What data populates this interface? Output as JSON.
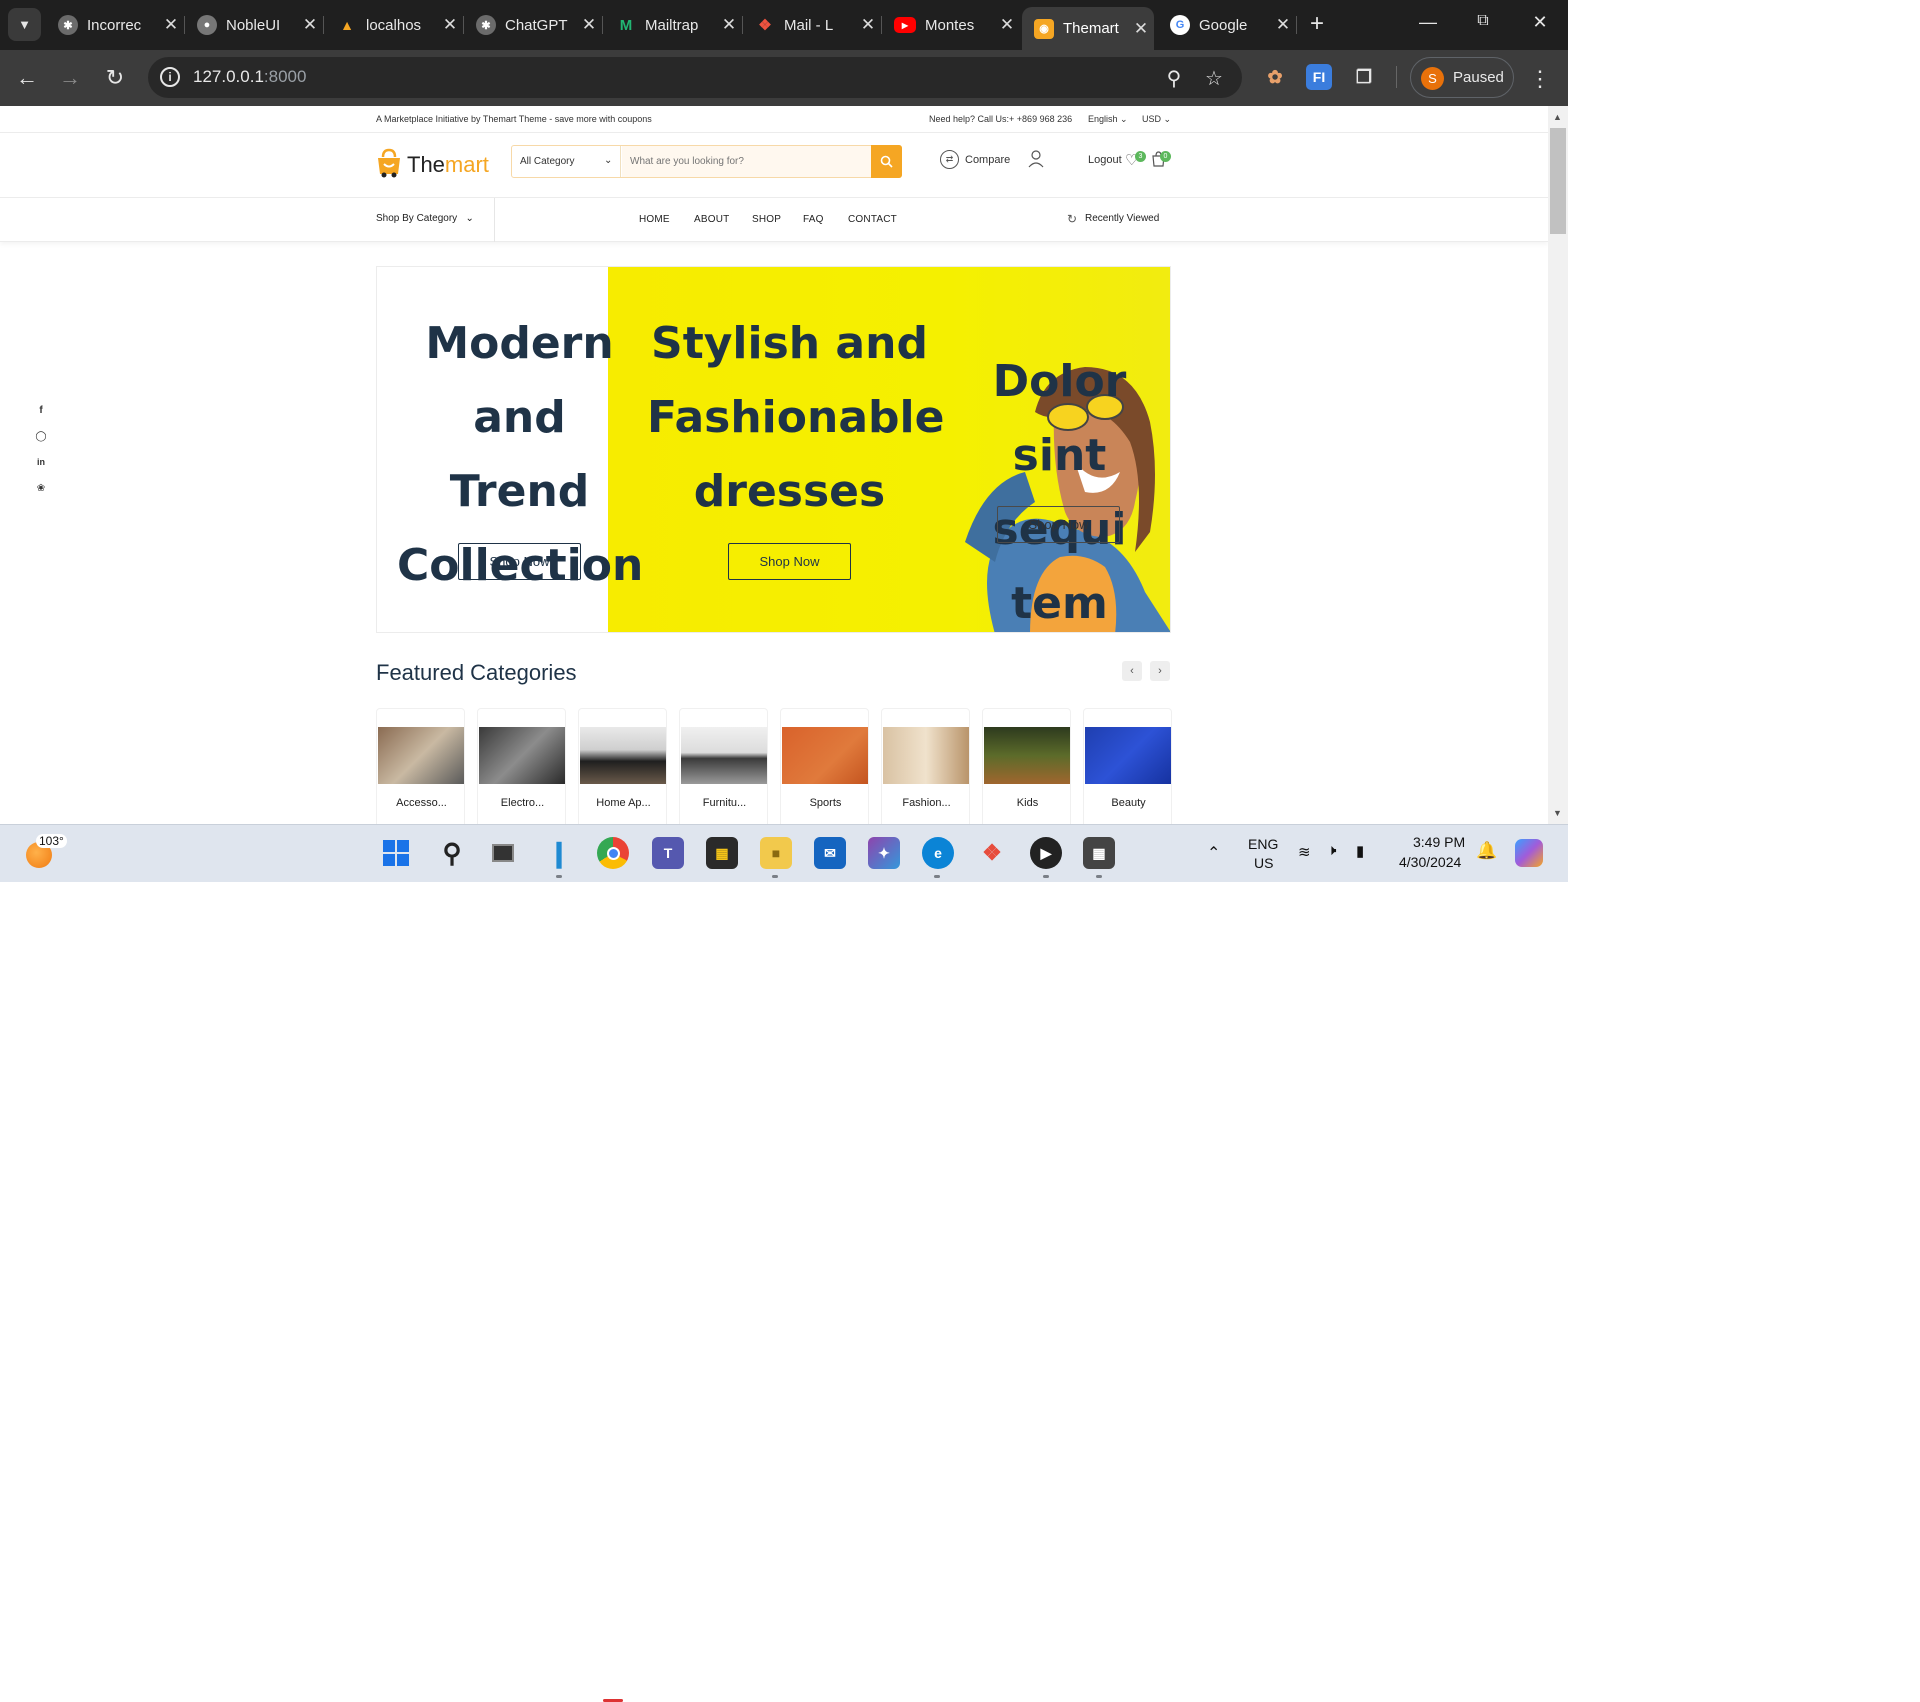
{
  "browser": {
    "tabs": [
      {
        "title": "Incorrec",
        "icon": "chatgpt-icon",
        "color": "#6b6b6b"
      },
      {
        "title": "NobleUI",
        "icon": "globe-icon",
        "color": "#777777"
      },
      {
        "title": "localhos",
        "icon": "localhost-icon",
        "color": "#333333"
      },
      {
        "title": "ChatGPT",
        "icon": "chatgpt-icon",
        "color": "#6b6b6b"
      },
      {
        "title": "Mailtrap",
        "icon": "mailtrap-icon",
        "color": "#22b573"
      },
      {
        "title": "Mail - L",
        "icon": "laravel-icon",
        "color": "#f05340"
      },
      {
        "title": "Montes",
        "icon": "youtube-icon",
        "color": "#ff0000"
      },
      {
        "title": "Themart",
        "icon": "themart-icon",
        "color": "#f5a623"
      },
      {
        "title": "Google",
        "icon": "google-icon",
        "color": "#4285f4"
      }
    ],
    "active_tab_index": 7,
    "url_host": "127.0.0.1",
    "url_port": ":8000",
    "profile_initial": "S",
    "profile_label": "Paused"
  },
  "site": {
    "topbar": {
      "tagline": "A Marketplace Initiative by Themart Theme - save more with coupons",
      "help": "Need help? Call Us:+ +869 968 236",
      "language": "English",
      "currency": "USD"
    },
    "logo": {
      "part1": "The",
      "part2": "mart"
    },
    "search": {
      "category": "All Category",
      "placeholder": "What are you looking for?"
    },
    "header_links": {
      "compare": "Compare",
      "logout": "Logout",
      "wishlist_count": "3",
      "cart_count": "0"
    },
    "nav": {
      "shop_by_category": "Shop By Category",
      "menu": [
        "HOME",
        "ABOUT",
        "SHOP",
        "FAQ",
        "CONTACT"
      ],
      "recently_viewed": "Recently Viewed"
    },
    "hero": {
      "slide1_lines": [
        "Modern",
        "and Trend",
        "Collection"
      ],
      "slide2_lines": [
        "Stylish and",
        "Fashionable",
        "dresses"
      ],
      "slide3_lines": [
        "Dolor sint",
        "sequi tem"
      ],
      "button": "Shop Now"
    },
    "featured": {
      "title": "Featured Categories",
      "categories": [
        "Accesso...",
        "Electro...",
        "Home Ap...",
        "Furnitu...",
        "Sports",
        "Fashion...",
        "Kids",
        "Beauty"
      ]
    },
    "social": [
      "f",
      "ig",
      "in",
      "tw"
    ]
  },
  "taskbar": {
    "weather": "103°",
    "lang_top": "ENG",
    "lang_bottom": "US",
    "time": "3:49 PM",
    "date": "4/30/2024"
  },
  "colors": {
    "brand": "#f5a623",
    "hero_yellow": "#f5f000",
    "heading": "#1f3347"
  }
}
